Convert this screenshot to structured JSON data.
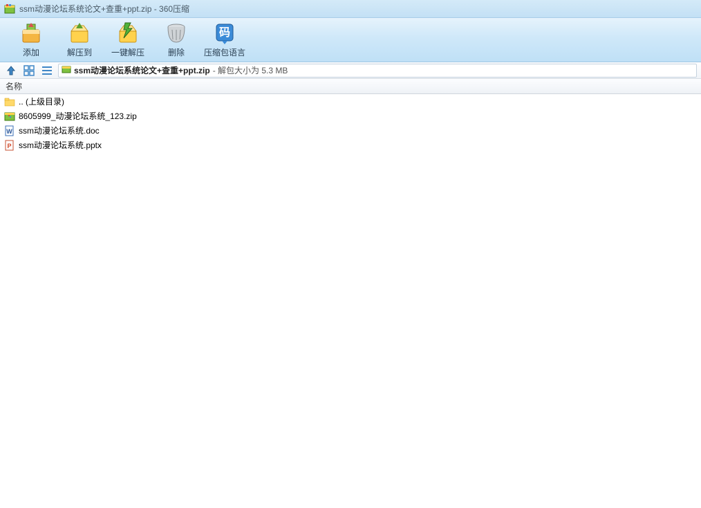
{
  "window": {
    "title": "ssm动漫论坛系统论文+查重+ppt.zip - 360压缩"
  },
  "toolbar": {
    "add": "添加",
    "extract_to": "解压到",
    "one_click_extract": "一键解压",
    "delete": "删除",
    "archive_lang": "压缩包语言"
  },
  "address": {
    "file": "ssm动漫论坛系统论文+查重+ppt.zip",
    "suffix": " - 解包大小为 5.3 MB"
  },
  "columns": {
    "name": "名称"
  },
  "rows": [
    {
      "icon": "folder",
      "name": ".. (上级目录)"
    },
    {
      "icon": "zip",
      "name": "8605999_动漫论坛系统_123.zip"
    },
    {
      "icon": "doc",
      "name": "ssm动漫论坛系统.doc"
    },
    {
      "icon": "pptx",
      "name": "ssm动漫论坛系统.pptx"
    }
  ]
}
